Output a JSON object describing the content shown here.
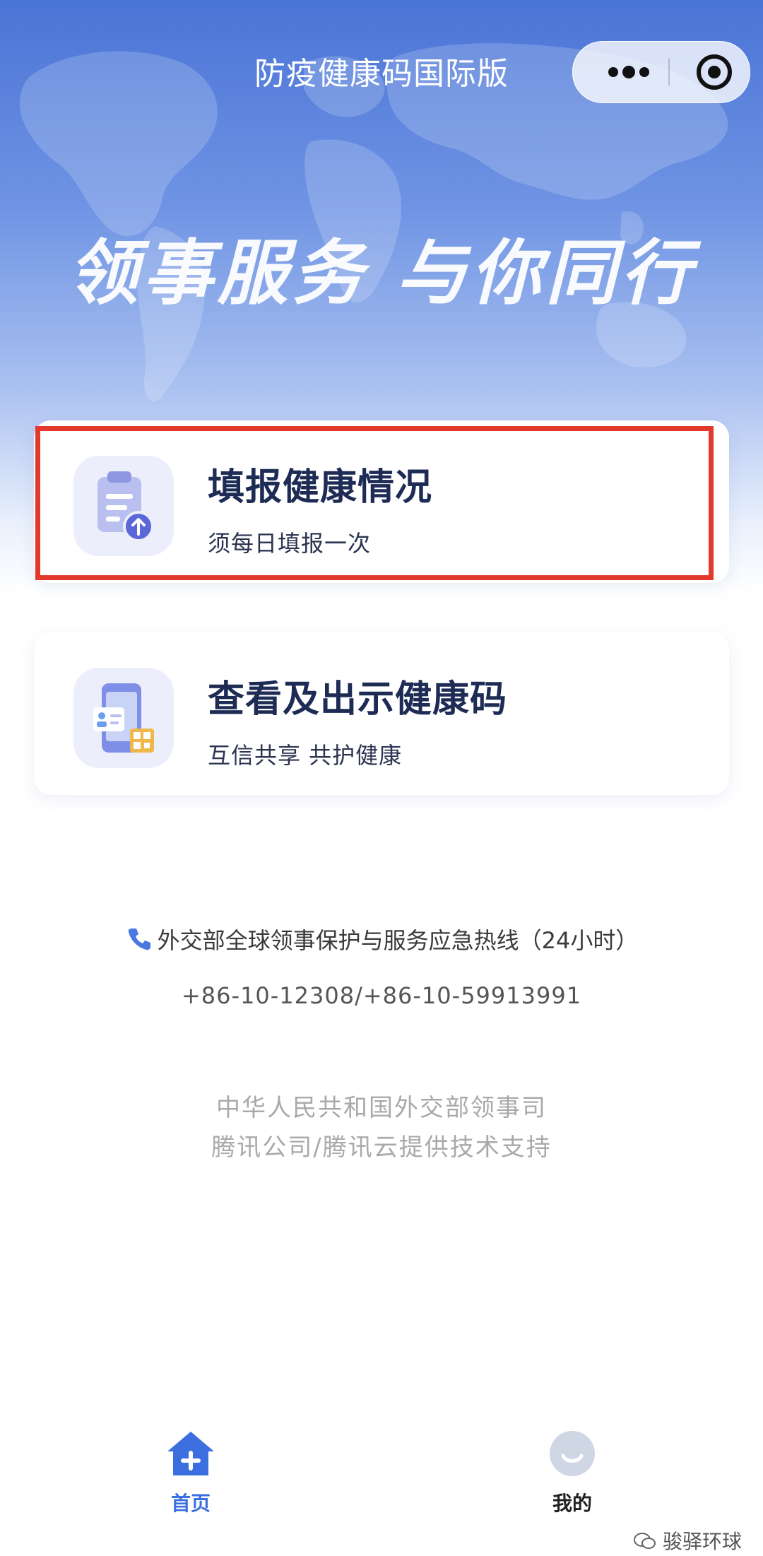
{
  "header": {
    "title": "防疫健康码国际版",
    "slogan": "领事服务 与你同行"
  },
  "capsule": {
    "more_icon": "more-dots-icon",
    "close_icon": "miniprogram-close-icon"
  },
  "cards": [
    {
      "title": "填报健康情况",
      "subtitle": "须每日填报一次",
      "icon": "clipboard-upload-icon",
      "highlighted": true
    },
    {
      "title": "查看及出示健康码",
      "subtitle": "互信共享 共护健康",
      "icon": "phone-qrcode-icon"
    }
  ],
  "hotline": {
    "label": "外交部全球领事保护与服务应急热线（24小时）",
    "numbers": "+86-10-12308/+86-10-59913991"
  },
  "footer": {
    "line1": "中华人民共和国外交部领事司",
    "line2": "腾讯公司/腾讯云提供技术支持"
  },
  "tabs": [
    {
      "label": "首页",
      "icon": "home-icon",
      "active": true
    },
    {
      "label": "我的",
      "icon": "avatar-icon",
      "active": false
    }
  ],
  "watermark": "骏驿环球",
  "colors": {
    "accent": "#3b6fe0",
    "highlight_border": "#e2392c",
    "card_title": "#1d2b55"
  }
}
